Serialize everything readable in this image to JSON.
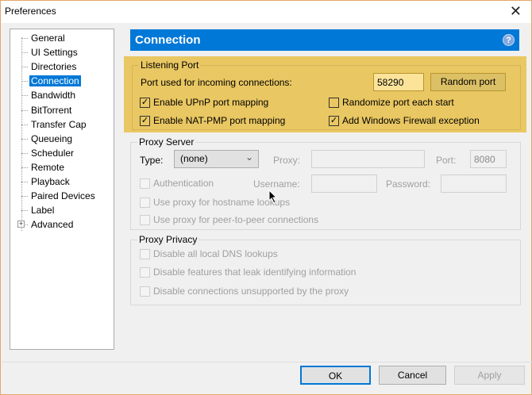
{
  "window": {
    "title": "Preferences",
    "close": "✕"
  },
  "sidebar": {
    "items": [
      {
        "label": "General"
      },
      {
        "label": "UI Settings"
      },
      {
        "label": "Directories"
      },
      {
        "label": "Connection",
        "selected": true
      },
      {
        "label": "Bandwidth"
      },
      {
        "label": "BitTorrent"
      },
      {
        "label": "Transfer Cap"
      },
      {
        "label": "Queueing"
      },
      {
        "label": "Scheduler"
      },
      {
        "label": "Remote"
      },
      {
        "label": "Playback"
      },
      {
        "label": "Paired Devices"
      },
      {
        "label": "Label"
      },
      {
        "label": "Advanced",
        "expandable": true
      }
    ],
    "expand_glyph": "+"
  },
  "header": {
    "title": "Connection",
    "help": "?"
  },
  "listening_port": {
    "title": "Listening Port",
    "port_label": "Port used for incoming connections:",
    "port_value": "58290",
    "random_port": "Random port",
    "upnp": {
      "label": "Enable UPnP port mapping",
      "checked": true
    },
    "natpmp": {
      "label": "Enable NAT-PMP port mapping",
      "checked": true
    },
    "randomize": {
      "label": "Randomize port each start",
      "checked": false
    },
    "firewall": {
      "label": "Add Windows Firewall exception",
      "checked": true
    }
  },
  "proxy_server": {
    "title": "Proxy Server",
    "type_label": "Type:",
    "type_value": "(none)",
    "chevron": "⌄",
    "proxy_label": "Proxy:",
    "proxy_value": "",
    "port_label": "Port:",
    "port_value": "8080",
    "auth": {
      "label": "Authentication",
      "checked": false
    },
    "username_label": "Username:",
    "password_label": "Password:",
    "hostname": {
      "label": "Use proxy for hostname lookups",
      "checked": false
    },
    "p2p": {
      "label": "Use proxy for peer-to-peer connections",
      "checked": false
    }
  },
  "proxy_privacy": {
    "title": "Proxy Privacy",
    "dns": {
      "label": "Disable all local DNS lookups",
      "checked": false
    },
    "leak": {
      "label": "Disable features that leak identifying information",
      "checked": false
    },
    "unsupported": {
      "label": "Disable connections unsupported by the proxy",
      "checked": false
    }
  },
  "footer": {
    "ok": "OK",
    "cancel": "Cancel",
    "apply": "Apply"
  },
  "check_glyph": "✓",
  "colors": {
    "accent": "#0078d7",
    "highlight": "#e9c762"
  }
}
